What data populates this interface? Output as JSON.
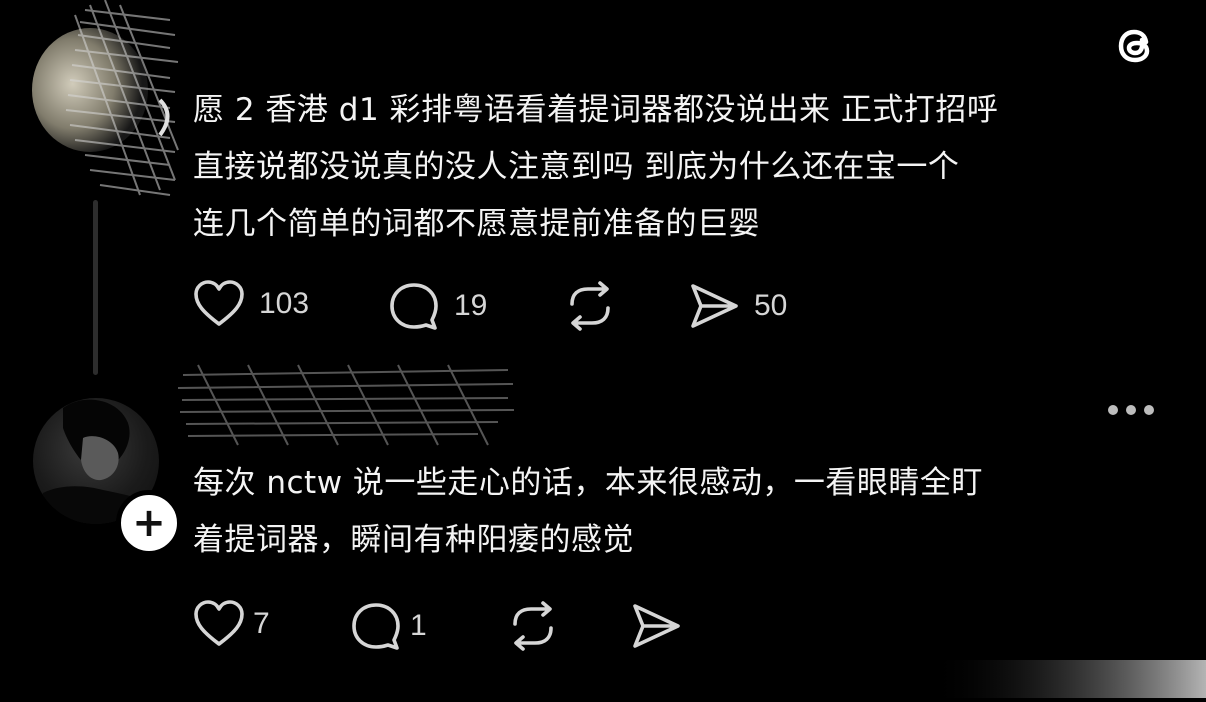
{
  "app": {
    "logo_icon": "threads-logo-icon"
  },
  "post1": {
    "text_lines": [
      "愿 2 香港 d1 彩排粤语看着提词器都没说出来 正式打招呼",
      "直接说都没说真的没人注意到吗 到底为什么还在宝一个",
      "连几个简单的词都不愿意提前准备的巨婴"
    ],
    "likes": "103",
    "replies": "19",
    "shares": "50"
  },
  "post2": {
    "text_lines": [
      "每次 nctw 说一些走心的话，本来很感动，一看眼睛全盯",
      "着提词器，瞬间有种阳痿的感觉"
    ],
    "likes": "7",
    "replies": "1",
    "follow_label": "+"
  }
}
